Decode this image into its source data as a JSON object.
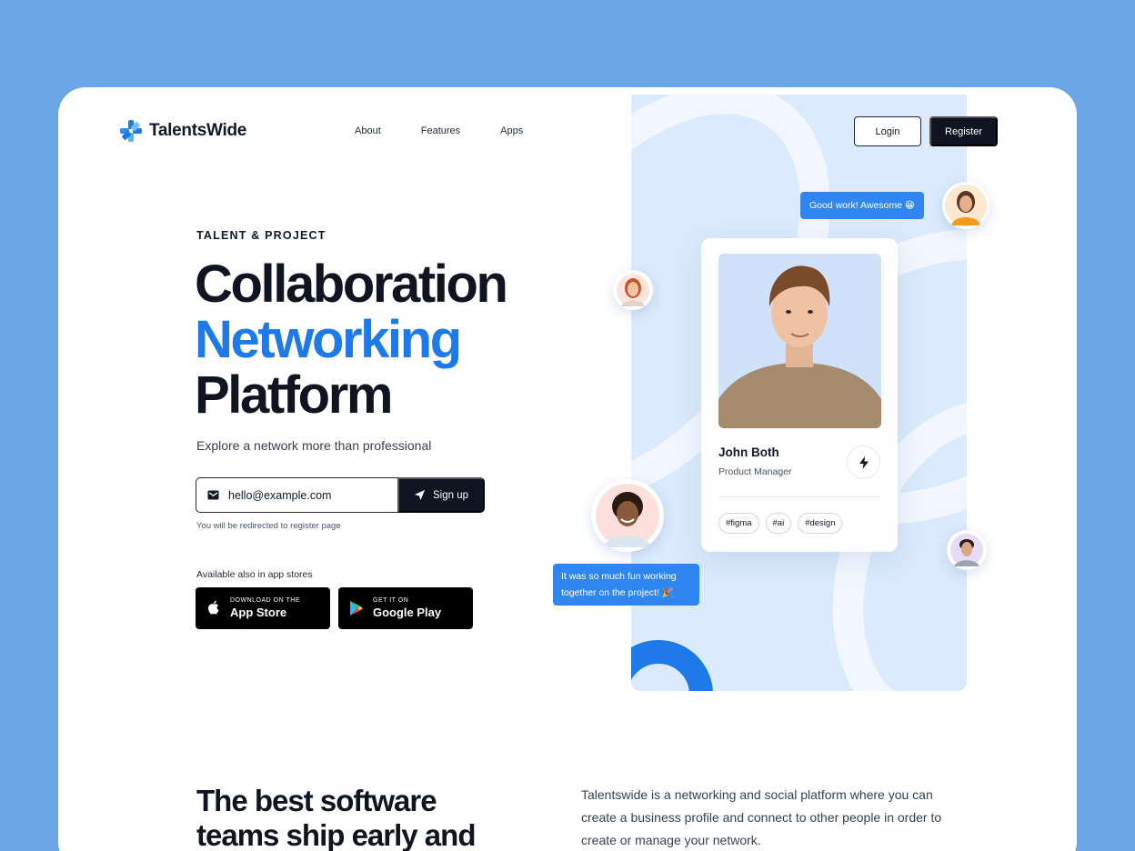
{
  "brand": {
    "name": "TalentsWide",
    "accent": "#1d7ae8",
    "dark": "#0f1420",
    "background": "#6aa6e6"
  },
  "nav": {
    "items": [
      "About",
      "Features",
      "Apps"
    ],
    "login": "Login",
    "register": "Register"
  },
  "hero": {
    "eyebrow": "TALENT & PROJECT",
    "title_line1": "Collaboration",
    "title_line2": "Networking",
    "title_line3": "Platform",
    "subtitle": "Explore a network more than professional",
    "email_value": "hello@example.com",
    "signup_label": "Sign up",
    "hint": "You will be redirected to register page",
    "stores_label": "Available also in app stores",
    "app_store": {
      "small": "DOWNLOAD ON THE",
      "big": "App Store"
    },
    "google_play": {
      "small": "GET IT ON",
      "big": "Google Play"
    }
  },
  "profile": {
    "name": "John Both",
    "role": "Product Manager",
    "tags": [
      "#figma",
      "#ai",
      "#design"
    ]
  },
  "bubbles": {
    "top": "Good work! Awesome 😁",
    "bottom_line1": "It was so much fun working",
    "bottom_line2": "together on the project! 🎉"
  },
  "section": {
    "heading": "The best software teams ship early and",
    "description": "Talentswide is a networking and social platform where you can create a business profile and connect to other people in order to create or manage your network."
  }
}
